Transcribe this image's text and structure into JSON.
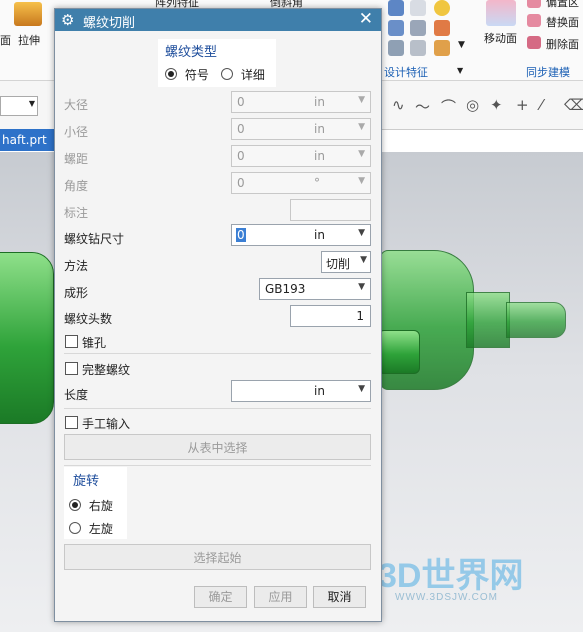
{
  "ribbon": {
    "left_labels": [
      "面",
      "拉伸"
    ],
    "items": [
      "阵列特征",
      "倒斜角",
      "移动面",
      "偏置区",
      "替换面",
      "删除面"
    ],
    "groups": [
      "设计特征",
      "同步建模"
    ]
  },
  "file_tab": "haft.prt",
  "dialog": {
    "title": "螺纹切削",
    "thread_type": {
      "title": "螺纹类型",
      "options": [
        {
          "label": "符号",
          "selected": true
        },
        {
          "label": "详细",
          "selected": false
        }
      ]
    },
    "rows": [
      {
        "label": "大径",
        "value": "0",
        "unit": "in",
        "enabled": false
      },
      {
        "label": "小径",
        "value": "0",
        "unit": "in",
        "enabled": false
      },
      {
        "label": "螺距",
        "value": "0",
        "unit": "in",
        "enabled": false
      },
      {
        "label": "角度",
        "value": "0",
        "unit": "°",
        "enabled": false
      }
    ],
    "callout_label": "标注",
    "tap_drill": {
      "label": "螺纹钻尺寸",
      "value": "0",
      "unit": "in"
    },
    "method": {
      "label": "方法",
      "value": "切削"
    },
    "forming": {
      "label": "成形",
      "value": "GB193"
    },
    "starts": {
      "label": "螺纹头数",
      "value": "1"
    },
    "tapered_label": "锥孔",
    "full_thread_label": "完整螺纹",
    "length": {
      "label": "长度",
      "unit": "in"
    },
    "manual_input_label": "手工输入",
    "choose_from_table": "从表中选择",
    "rotation": {
      "title": "旋转",
      "options": [
        {
          "label": "右旋",
          "selected": true
        },
        {
          "label": "左旋",
          "selected": false
        }
      ]
    },
    "select_start": "选择起始",
    "buttons": {
      "ok": "确定",
      "apply": "应用",
      "cancel": "取消"
    }
  },
  "watermark": {
    "brand": "3D世界网",
    "url": "WWW.3DSJW.COM"
  },
  "colors": {
    "titlebar": "#3f7fab",
    "part_green": "#2fa33a",
    "file_tab": "#2e72c9"
  }
}
